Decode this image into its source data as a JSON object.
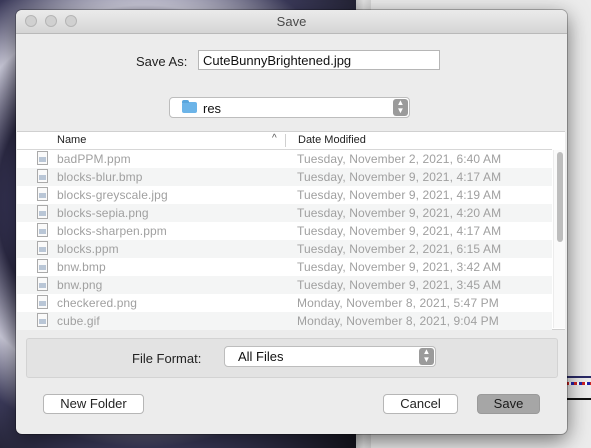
{
  "dialog": {
    "title": "Save",
    "save_as_label": "Save As:",
    "save_as_value": "CuteBunnyBrightened.jpg",
    "folder": {
      "name": "res",
      "icon": "folder-icon"
    },
    "columns": {
      "name": "Name",
      "date": "Date Modified"
    },
    "files": [
      {
        "name": "badPPM.ppm",
        "date": "Tuesday, November 2, 2021, 6:40 AM"
      },
      {
        "name": "blocks-blur.bmp",
        "date": "Tuesday, November 9, 2021, 4:17 AM"
      },
      {
        "name": "blocks-greyscale.jpg",
        "date": "Tuesday, November 9, 2021, 4:19 AM"
      },
      {
        "name": "blocks-sepia.png",
        "date": "Tuesday, November 9, 2021, 4:20 AM"
      },
      {
        "name": "blocks-sharpen.ppm",
        "date": "Tuesday, November 9, 2021, 4:17 AM"
      },
      {
        "name": "blocks.ppm",
        "date": "Tuesday, November 2, 2021, 6:15 AM"
      },
      {
        "name": "bnw.bmp",
        "date": "Tuesday, November 9, 2021, 3:42 AM"
      },
      {
        "name": "bnw.png",
        "date": "Tuesday, November 9, 2021, 3:45 AM"
      },
      {
        "name": "checkered.png",
        "date": "Monday, November 8, 2021, 5:47 PM"
      },
      {
        "name": "cube.gif",
        "date": "Monday, November 8, 2021, 9:04 PM"
      }
    ],
    "file_format_label": "File Format:",
    "file_format_value": "All Files",
    "buttons": {
      "new_folder": "New Folder",
      "cancel": "Cancel",
      "save": "Save"
    }
  }
}
